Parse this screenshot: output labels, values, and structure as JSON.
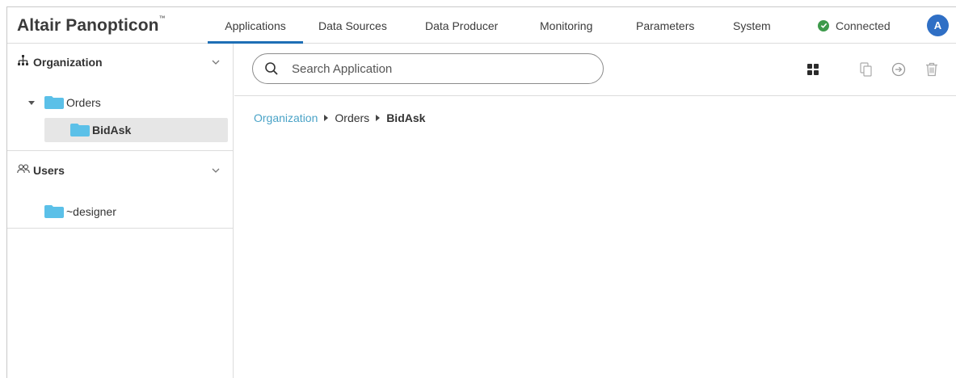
{
  "app": {
    "brand": "Altair Panopticon",
    "brand_tm": "™"
  },
  "nav": {
    "tabs": [
      {
        "label": "Applications",
        "active": true
      },
      {
        "label": "Data Sources"
      },
      {
        "label": "Data Producer"
      },
      {
        "label": "Monitoring"
      },
      {
        "label": "Parameters"
      },
      {
        "label": "System"
      }
    ],
    "status": {
      "label": "Connected",
      "color": "#3d9a4b"
    },
    "avatar": {
      "initial": "A",
      "color": "#2f6fc5"
    }
  },
  "sidebar": {
    "organization": {
      "title": "Organization",
      "icon": "hierarchy-icon",
      "items": [
        {
          "label": "Orders",
          "expanded": true
        },
        {
          "label": "BidAsk",
          "selected": true
        }
      ]
    },
    "users": {
      "title": "Users",
      "icon": "users-icon",
      "items": [
        {
          "label": "~designer"
        }
      ]
    }
  },
  "main": {
    "search": {
      "placeholder": "Search Application",
      "value": ""
    },
    "toolbar_icons": [
      "grid-view-icon",
      "copy-icon",
      "move-icon",
      "trash-icon"
    ],
    "breadcrumb": {
      "root": "Organization",
      "middle": "Orders",
      "current": "BidAsk"
    }
  },
  "colors": {
    "accent": "#1e6fb5",
    "folder": "#5bc0e8",
    "link": "#4aa3c7"
  }
}
